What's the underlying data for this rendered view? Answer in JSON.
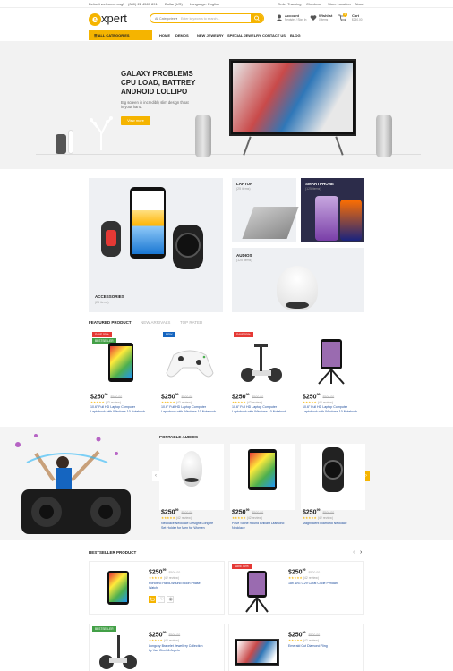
{
  "topbar": {
    "welcome": "Default welcome msg!",
    "phone": "(080) 22 4567 891",
    "currency": "Dollar (US)",
    "language": "Language: English",
    "order_tracking": "Order Tracking",
    "checkout": "Checkout",
    "store_location": "Store Location",
    "about": "About"
  },
  "header": {
    "logo_letter": "e",
    "logo_text": "xpert",
    "search_category": "All Categories",
    "search_placeholder": "Enter keywords to search...",
    "account_title": "Account",
    "account_sub": "Register / Sign In",
    "wishlist_title": "Wishlist",
    "wishlist_sub": "0 items",
    "cart_title": "Cart",
    "cart_sub": "$250.00",
    "cart_count": "0"
  },
  "nav": {
    "all_categories": "ALL CATEGORIES",
    "items": [
      "HOME",
      "DEMOS",
      "NEW JEWELRY",
      "SPECIAL JEWELRY",
      "CONTACT US",
      "BLOG"
    ]
  },
  "hero": {
    "title_lines": [
      "GALAXY PROBLEMS",
      "CPU LOAD, BATTREY",
      "ANDROID LOLLIPO"
    ],
    "subtitle": "Big screen in incredibly slim design thpat in your hand.",
    "button": "View more"
  },
  "categories": [
    {
      "label": "ACCESSORIES",
      "count": "(25 items)"
    },
    {
      "label": "LAPTOP",
      "count": "(25 items)"
    },
    {
      "label": "SMARTPHONE",
      "count": "(125 items)"
    },
    {
      "label": "AUDIOS",
      "count": "(125 items)"
    }
  ],
  "featured": {
    "tabs": [
      "FEATURED PRODUCT",
      "NEW ARRIVALS",
      "TOP RATED"
    ],
    "products": [
      {
        "badge1": "SAVE 50%",
        "badge2": "BESTSELLER",
        "price": "$250",
        "cents": "99",
        "old": "$500.00",
        "stars": "★★★★★",
        "reviews": "(42 review)",
        "title1": "10.6\" Full HD Laptop Computer",
        "title2": "Laptobook with Windows 10 Notebook"
      },
      {
        "badge1": "NEW",
        "badge2": "",
        "price": "$250",
        "cents": "99",
        "old": "$500.00",
        "stars": "★★★★★",
        "reviews": "(42 review)",
        "title1": "10.6\" Full HD Laptop Computer",
        "title2": "Laptobook with Windows 10 Notebook"
      },
      {
        "badge1": "SAVE 50%",
        "badge2": "",
        "price": "$250",
        "cents": "99",
        "old": "$500.00",
        "stars": "★★★★★",
        "reviews": "(42 review)",
        "title1": "10.6\" Full HD Laptop Computer",
        "title2": "Laptobook with Windows 10 Notebook"
      },
      {
        "badge1": "",
        "badge2": "",
        "price": "$250",
        "cents": "99",
        "old": "$500.00",
        "stars": "★★★★★",
        "reviews": "(42 review)",
        "title1": "10.6\" Full HD Laptop Computer",
        "title2": "Laptobook with Windows 10 Notebook"
      }
    ]
  },
  "portable": {
    "heading": "PORTABLE AUDIOS",
    "products": [
      {
        "price": "$250",
        "cents": "99",
        "old": "$500.00",
        "stars": "★★★★★",
        "reviews": "(42 review)",
        "title1": "Necklace Necklace Designs Longlife",
        "title2": "Set Holder for Men for Women"
      },
      {
        "price": "$250",
        "cents": "99",
        "old": "$500.00",
        "stars": "★★★★★",
        "reviews": "(42 review)",
        "title1": "Pave Stone Round Brilliant Diamond",
        "title2": "Necklace"
      },
      {
        "price": "$250",
        "cents": "99",
        "old": "$500.00",
        "stars": "★★★★★",
        "reviews": "(42 review)",
        "title1": "Magnificent Diamond Necklace",
        "title2": ""
      }
    ]
  },
  "bestseller": {
    "heading": "BESTSELLER PRODUCT",
    "products": [
      {
        "badge": "",
        "price": "$250",
        "cents": "99",
        "old": "$500.00",
        "stars": "★★★★★",
        "reviews": "(42 review)",
        "title1": "Portofino Hand-Wound Moon Phase",
        "title2": "Watch"
      },
      {
        "badge": "SAVE 50%",
        "price": "$250",
        "cents": "99",
        "old": "$500.00",
        "stars": "★★★★★",
        "reviews": "(42 review)",
        "title1": "18K WG 0.29 Carat Circle Pendant",
        "title2": ""
      },
      {
        "badge": "BESTSELLER",
        "price": "$250",
        "cents": "99",
        "old": "$500.00",
        "stars": "★★★★★",
        "reviews": "(42 review)",
        "title1": "Longchy Bracelet Jewellery Collection",
        "title2": "by Van Cleef & Arpels"
      },
      {
        "badge": "",
        "price": "$250",
        "cents": "99",
        "old": "$500.00",
        "stars": "★★★★★",
        "reviews": "(42 review)",
        "title1": "Emerald Cut Diamond Ring",
        "title2": ""
      }
    ]
  },
  "colors": {
    "accent": "#f5b400",
    "sale": "#e53935",
    "new": "#1565c0",
    "best": "#43a047"
  }
}
